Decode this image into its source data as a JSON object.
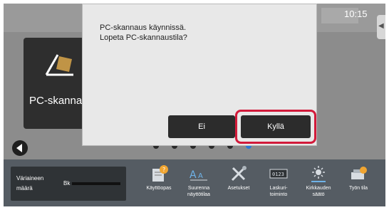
{
  "status_bar": {
    "time": "10:15"
  },
  "home_tile": {
    "label": "PC-skannaus"
  },
  "pagination": {
    "count": 6,
    "active_index": 5
  },
  "dialog": {
    "message_line1": "PC-skannaus käynnissä.",
    "message_line2": "Lopeta PC-skannaustila?",
    "no_label": "Ei",
    "yes_label": "Kyllä"
  },
  "toner": {
    "label_line1": "Väriaineen",
    "label_line2": "määrä",
    "color_label": "Bk"
  },
  "bottom_items": [
    {
      "label": "Käyttöopas",
      "icon": "manual-icon"
    },
    {
      "label": "Suurenna\nnäyttötilaa",
      "icon": "enlarge-display-icon"
    },
    {
      "label": "Asetukset",
      "icon": "settings-icon"
    },
    {
      "label": "Laskuri-\ntoiminto",
      "icon": "counter-icon"
    },
    {
      "label": "Kirkkauden\nsäätö",
      "icon": "brightness-icon"
    },
    {
      "label": "Työn tila",
      "icon": "job-status-icon"
    }
  ],
  "colors": {
    "highlight_ring": "#d21a3a",
    "active_dot": "#2b76d6",
    "button": "#2c2c2c"
  }
}
